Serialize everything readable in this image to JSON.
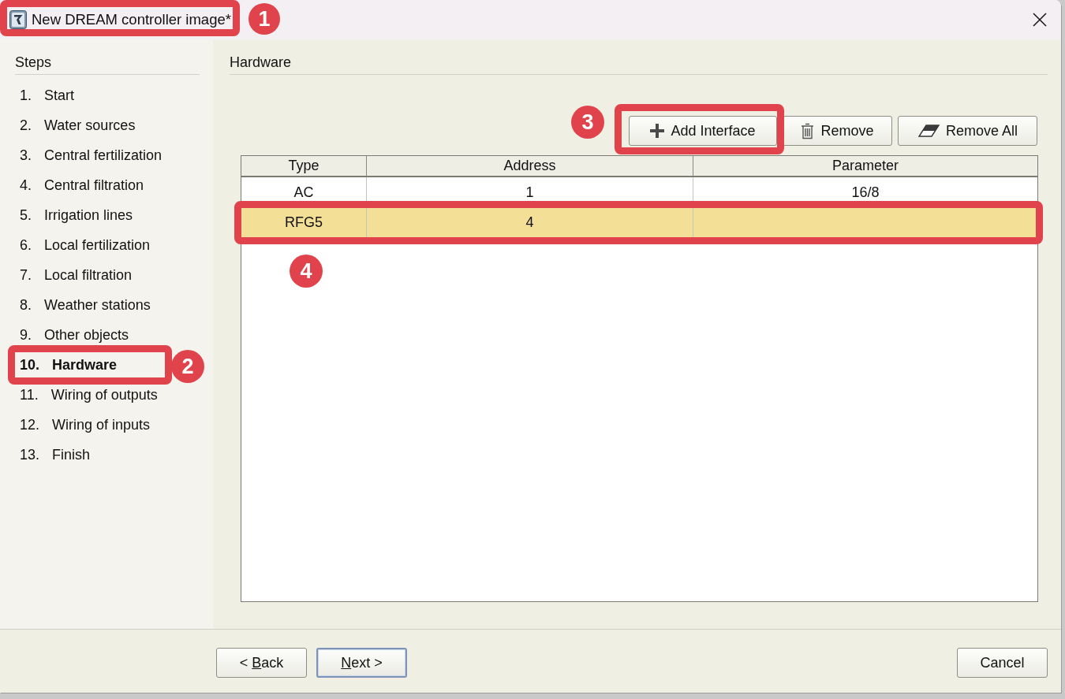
{
  "window": {
    "title": "New DREAM controller image*",
    "callout": "1"
  },
  "steps": {
    "heading": "Steps",
    "items": [
      {
        "number": "1.",
        "label": "Start",
        "selected": false
      },
      {
        "number": "2.",
        "label": "Water sources",
        "selected": false
      },
      {
        "number": "3.",
        "label": "Central fertilization",
        "selected": false
      },
      {
        "number": "4.",
        "label": "Central filtration",
        "selected": false
      },
      {
        "number": "5.",
        "label": "Irrigation lines",
        "selected": false
      },
      {
        "number": "6.",
        "label": "Local fertilization",
        "selected": false
      },
      {
        "number": "7.",
        "label": "Local filtration",
        "selected": false
      },
      {
        "number": "8.",
        "label": "Weather stations",
        "selected": false
      },
      {
        "number": "9.",
        "label": "Other objects",
        "selected": false
      },
      {
        "number": "10.",
        "label": "Hardware",
        "selected": true,
        "callout": "2"
      },
      {
        "number": "11.",
        "label": "Wiring of outputs",
        "selected": false
      },
      {
        "number": "12.",
        "label": "Wiring of inputs",
        "selected": false
      },
      {
        "number": "13.",
        "label": "Finish",
        "selected": false
      }
    ]
  },
  "page": {
    "heading": "Hardware"
  },
  "toolbar": [
    {
      "kind": "add",
      "label": "Add Interface",
      "callout": "3"
    },
    {
      "kind": "remove",
      "label": "Remove"
    },
    {
      "kind": "clear",
      "label": "Remove All"
    }
  ],
  "table": {
    "columns": [
      "Type",
      "Address",
      "Parameter"
    ],
    "rows": [
      {
        "cells": [
          "AC",
          "1",
          "16/8"
        ],
        "selected": false
      },
      {
        "cells": [
          "RFG5",
          "4"
        ],
        "selected": true,
        "callout": "4"
      }
    ]
  },
  "footer": {
    "navigation": [
      {
        "label": "< Back",
        "underline_shortcut": true,
        "focused": false
      },
      {
        "label": "Next >",
        "underline_shortcut": true,
        "focused": true
      }
    ],
    "cancel": {
      "label": "Cancel",
      "underline_shortcut": false,
      "focused": false
    }
  }
}
